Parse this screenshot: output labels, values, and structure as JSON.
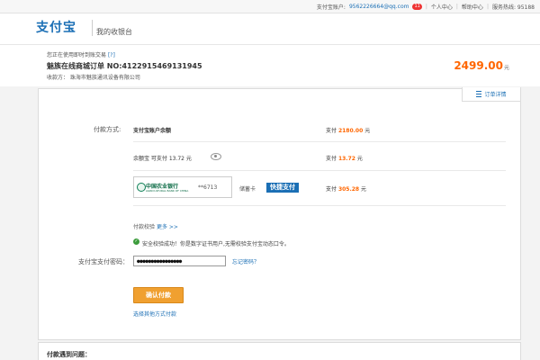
{
  "topbar": {
    "account_label": "支付宝账户:",
    "account": "9562226664@qq.com",
    "badge": "11",
    "personal_center": "个人中心",
    "help": "帮助中心",
    "hotline": "服务热线: 95188"
  },
  "header": {
    "logo": "支付宝",
    "cashier": "我的收银台"
  },
  "summary": {
    "warning": "您正在使用即时到账交易",
    "warning_q": "[?]",
    "order": "魅族在线商城订单  NO:4122915469131945",
    "payee": "收款方：  珠海市魅族通讯设备有限公司",
    "amount": "2499.00",
    "amount_unit": "元"
  },
  "detail_btn": "订单详情",
  "payment": {
    "method_label": "付款方式:",
    "account_balance": "支付宝账户余额",
    "pay1_label": "支付",
    "pay1_amount": "2180.00",
    "pay_unit": "元",
    "yuebao": "余额宝  可支付  13.72 元",
    "pay2_label": "支付",
    "pay2_amount": "13.72",
    "bank_name": "中国农业银行",
    "bank_en": "AGRICULTURAL BANK OF CHINA",
    "card_tail": "**6713",
    "card_type": "储蓄卡",
    "kuaijie": "快捷支付",
    "pay3_label": "支付",
    "pay3_amount": "305.28",
    "security_label": "付款校验",
    "security_link": "更多 >>",
    "security_ok": "安全校验成功！你是数字证书用户,无需校验支付宝动态口令。",
    "password_label": "支付宝支付密码：",
    "password_value": "●●●●●●●●●●●●●●●●",
    "forgot": "忘记密码？",
    "confirm": "确认付款",
    "other_method": "选择其他方式付款"
  },
  "footer": {
    "title": "付款遇到问题："
  }
}
